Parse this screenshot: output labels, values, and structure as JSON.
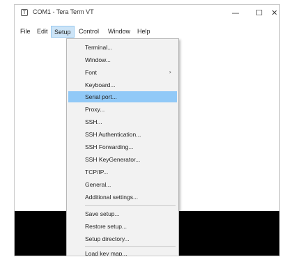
{
  "window": {
    "title": "COM1 - Tera Term VT",
    "icon_label": "T",
    "minimize": "—",
    "maximize": "☐",
    "close": "✕"
  },
  "menubar": [
    "File",
    "Edit",
    "Setup",
    "Control",
    "Window",
    "Help"
  ],
  "setup_menu": {
    "items": [
      {
        "label": "Terminal..."
      },
      {
        "label": "Window..."
      },
      {
        "label": "Font",
        "submenu": true
      },
      {
        "label": "Keyboard..."
      },
      {
        "label": "Serial port...",
        "highlighted": true
      },
      {
        "label": "Proxy..."
      },
      {
        "label": "SSH..."
      },
      {
        "label": "SSH Authentication..."
      },
      {
        "label": "SSH Forwarding..."
      },
      {
        "label": "SSH KeyGenerator..."
      },
      {
        "label": "TCP/IP..."
      },
      {
        "label": "General..."
      },
      {
        "label": "Additional settings..."
      },
      {
        "label": "Save setup..."
      },
      {
        "label": "Restore setup..."
      },
      {
        "label": "Setup directory..."
      },
      {
        "label": "Load key map..."
      }
    ],
    "submenu_arrow": "›"
  },
  "colors": {
    "highlight": "#91c9f7",
    "terminal_bg": "#000000"
  }
}
